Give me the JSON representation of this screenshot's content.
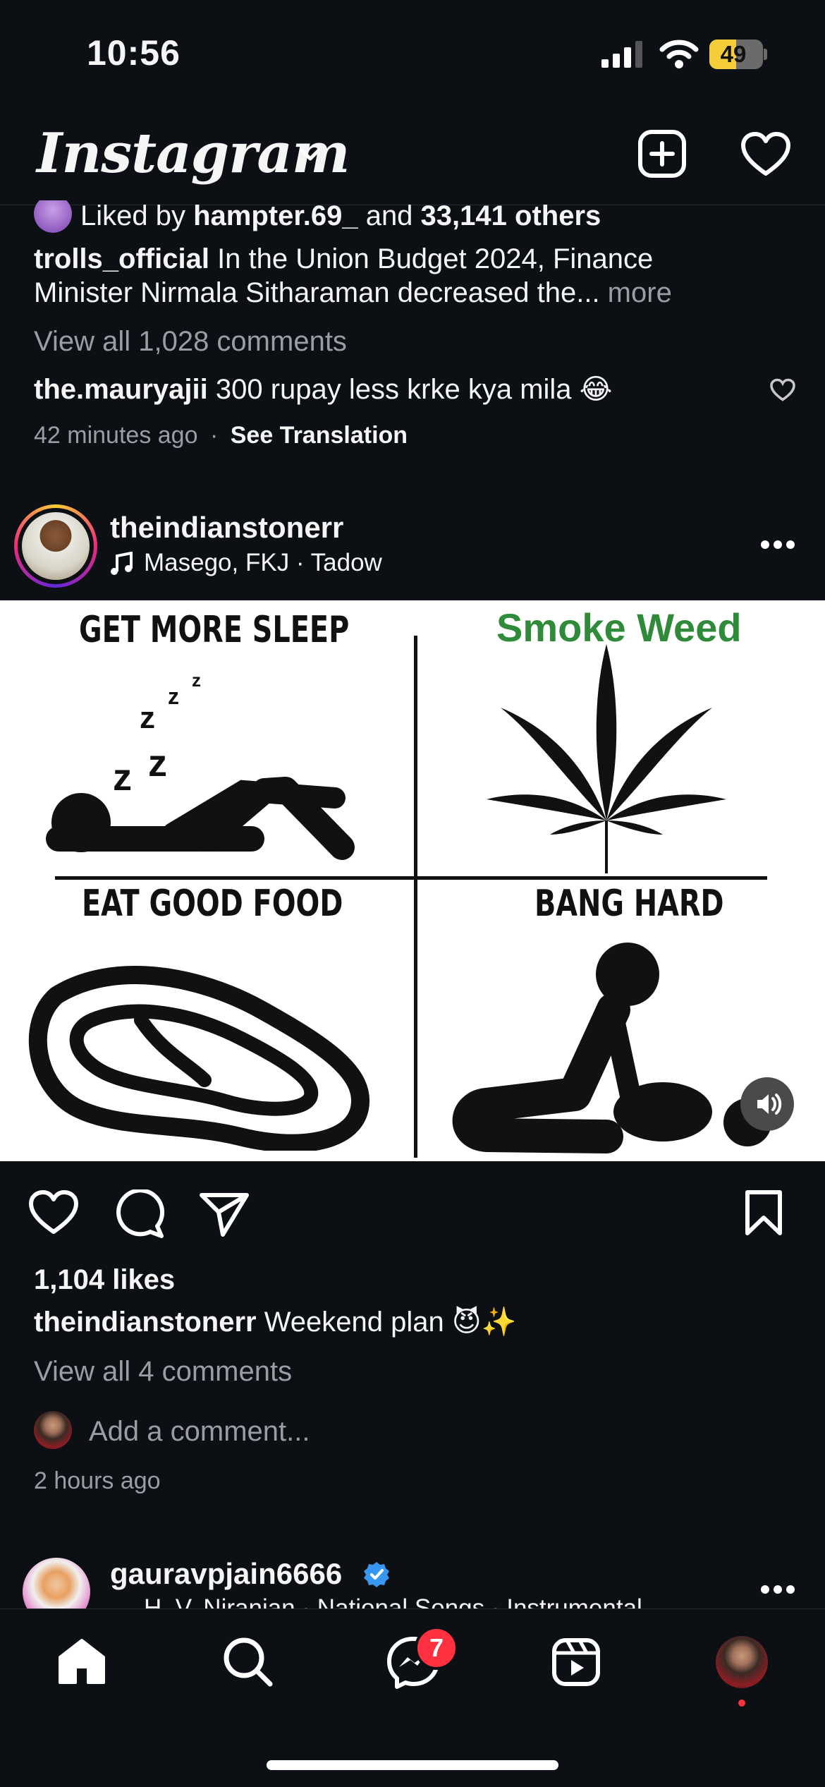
{
  "status_bar": {
    "time": "10:56",
    "battery": "49"
  },
  "header": {
    "logo": "Instagram"
  },
  "prev_post": {
    "liked_by_prefix": "Liked by ",
    "liked_by_user": "hampter.69_",
    "liked_by_and": " and ",
    "liked_by_others": "33,141 others",
    "caption_user": "trolls_official",
    "caption_line1": " In the Union Budget 2024, Finance",
    "caption_line2": "Minister Nirmala Sitharaman decreased the...",
    "more": " more",
    "view_comments": "View all 1,028 comments",
    "comment_user": "the.mauryajii",
    "comment_text": " 300  rupay less krke kya mila 😂",
    "time_ago": "42 minutes ago",
    "dot": "·",
    "see_translation": "See Translation"
  },
  "post": {
    "username": "theindianstonerr",
    "audio": "Masego, FKJ · Tadow",
    "meme": {
      "label_1": "GET MORE SLEEP",
      "label_2": "Smoke Weed",
      "label_3": "EAT GOOD FOOD",
      "label_4": "BANG HARD",
      "zzz": "z"
    },
    "likes": "1,104 likes",
    "caption_user": "theindianstonerr",
    "caption_text": " Weekend plan 😈✨",
    "view_comments": "View all 4 comments",
    "add_comment_placeholder": "Add a comment...",
    "time_ago": "2 hours ago"
  },
  "next_post": {
    "username": "gauravpjain6666",
    "audio": "H. V. Niranjan · National Songs · Instrumental"
  },
  "nav": {
    "messages_badge": "7"
  },
  "icons": [
    "chevron-down-icon",
    "new-post-icon",
    "heart-icon",
    "like-icon",
    "comment-icon",
    "share-icon",
    "save-icon",
    "more-icon",
    "music-icon",
    "mute-icon",
    "home-icon",
    "search-icon",
    "messenger-icon",
    "reels-icon",
    "verified-icon"
  ],
  "colors": {
    "background": "#0c0f14",
    "badge": "#ff3040",
    "verified": "#3897f0",
    "battery": "#f5cd3a"
  }
}
